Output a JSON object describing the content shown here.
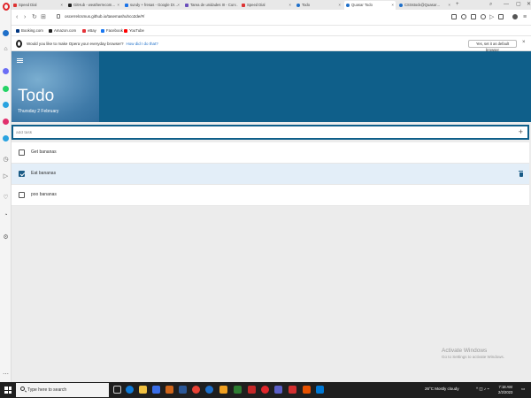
{
  "browser": {
    "tabs": [
      {
        "title": "Speed Dial",
        "color": "#d33"
      },
      {
        "title": "GitHub - weatherrecom…",
        "color": "#222"
      },
      {
        "title": "sundy + fresas - Google Dr…",
        "color": "#1a73e8"
      },
      {
        "title": "Tarea de unidades III - Cur…",
        "color": "#6b4fbb"
      },
      {
        "title": "Speed Dial",
        "color": "#d33"
      },
      {
        "title": "Todo",
        "color": "#1e6fc9"
      },
      {
        "title": "Quasar Todo",
        "color": "#1e6fc9"
      },
      {
        "title": "CSSstock@Quasar…",
        "color": "#1e6fc9"
      }
    ],
    "url": "oscerrelcsmus.github.io/tasemashuhco2de/#/",
    "bookmarks": [
      {
        "label": "Booking.com",
        "color": "#003580"
      },
      {
        "label": "Amazon.com",
        "color": "#222"
      },
      {
        "label": "eBay",
        "color": "#e53238"
      },
      {
        "label": "Facebook",
        "color": "#1877f2"
      },
      {
        "label": "YouTube",
        "color": "#ff0000"
      }
    ],
    "default_prompt": "Would you like to make Opera your everyday browser?",
    "default_link": "How did I do that?",
    "default_button": "Yes, set it as default browser"
  },
  "app": {
    "title": "Todo",
    "date": "Thursday 2 February",
    "add_placeholder": "add task",
    "add_icon": "+",
    "colors": {
      "primary": "#0f5f8a",
      "hover_row": "#e3eef8",
      "checkbox_checked": "#1a5b86"
    },
    "todos": [
      {
        "text": "Get bananas",
        "done": false
      },
      {
        "text": "Eat bananas",
        "done": true
      },
      {
        "text": "poo bananas",
        "done": false
      }
    ]
  },
  "watermark": {
    "title": "Activate Windows",
    "subtitle": "Go to Settings to activate Windows."
  },
  "taskbar": {
    "search_placeholder": "Type here to search",
    "weather": "26°C  Mostly cloudy",
    "time": "7:18 AM",
    "date": "2/2/2023"
  }
}
